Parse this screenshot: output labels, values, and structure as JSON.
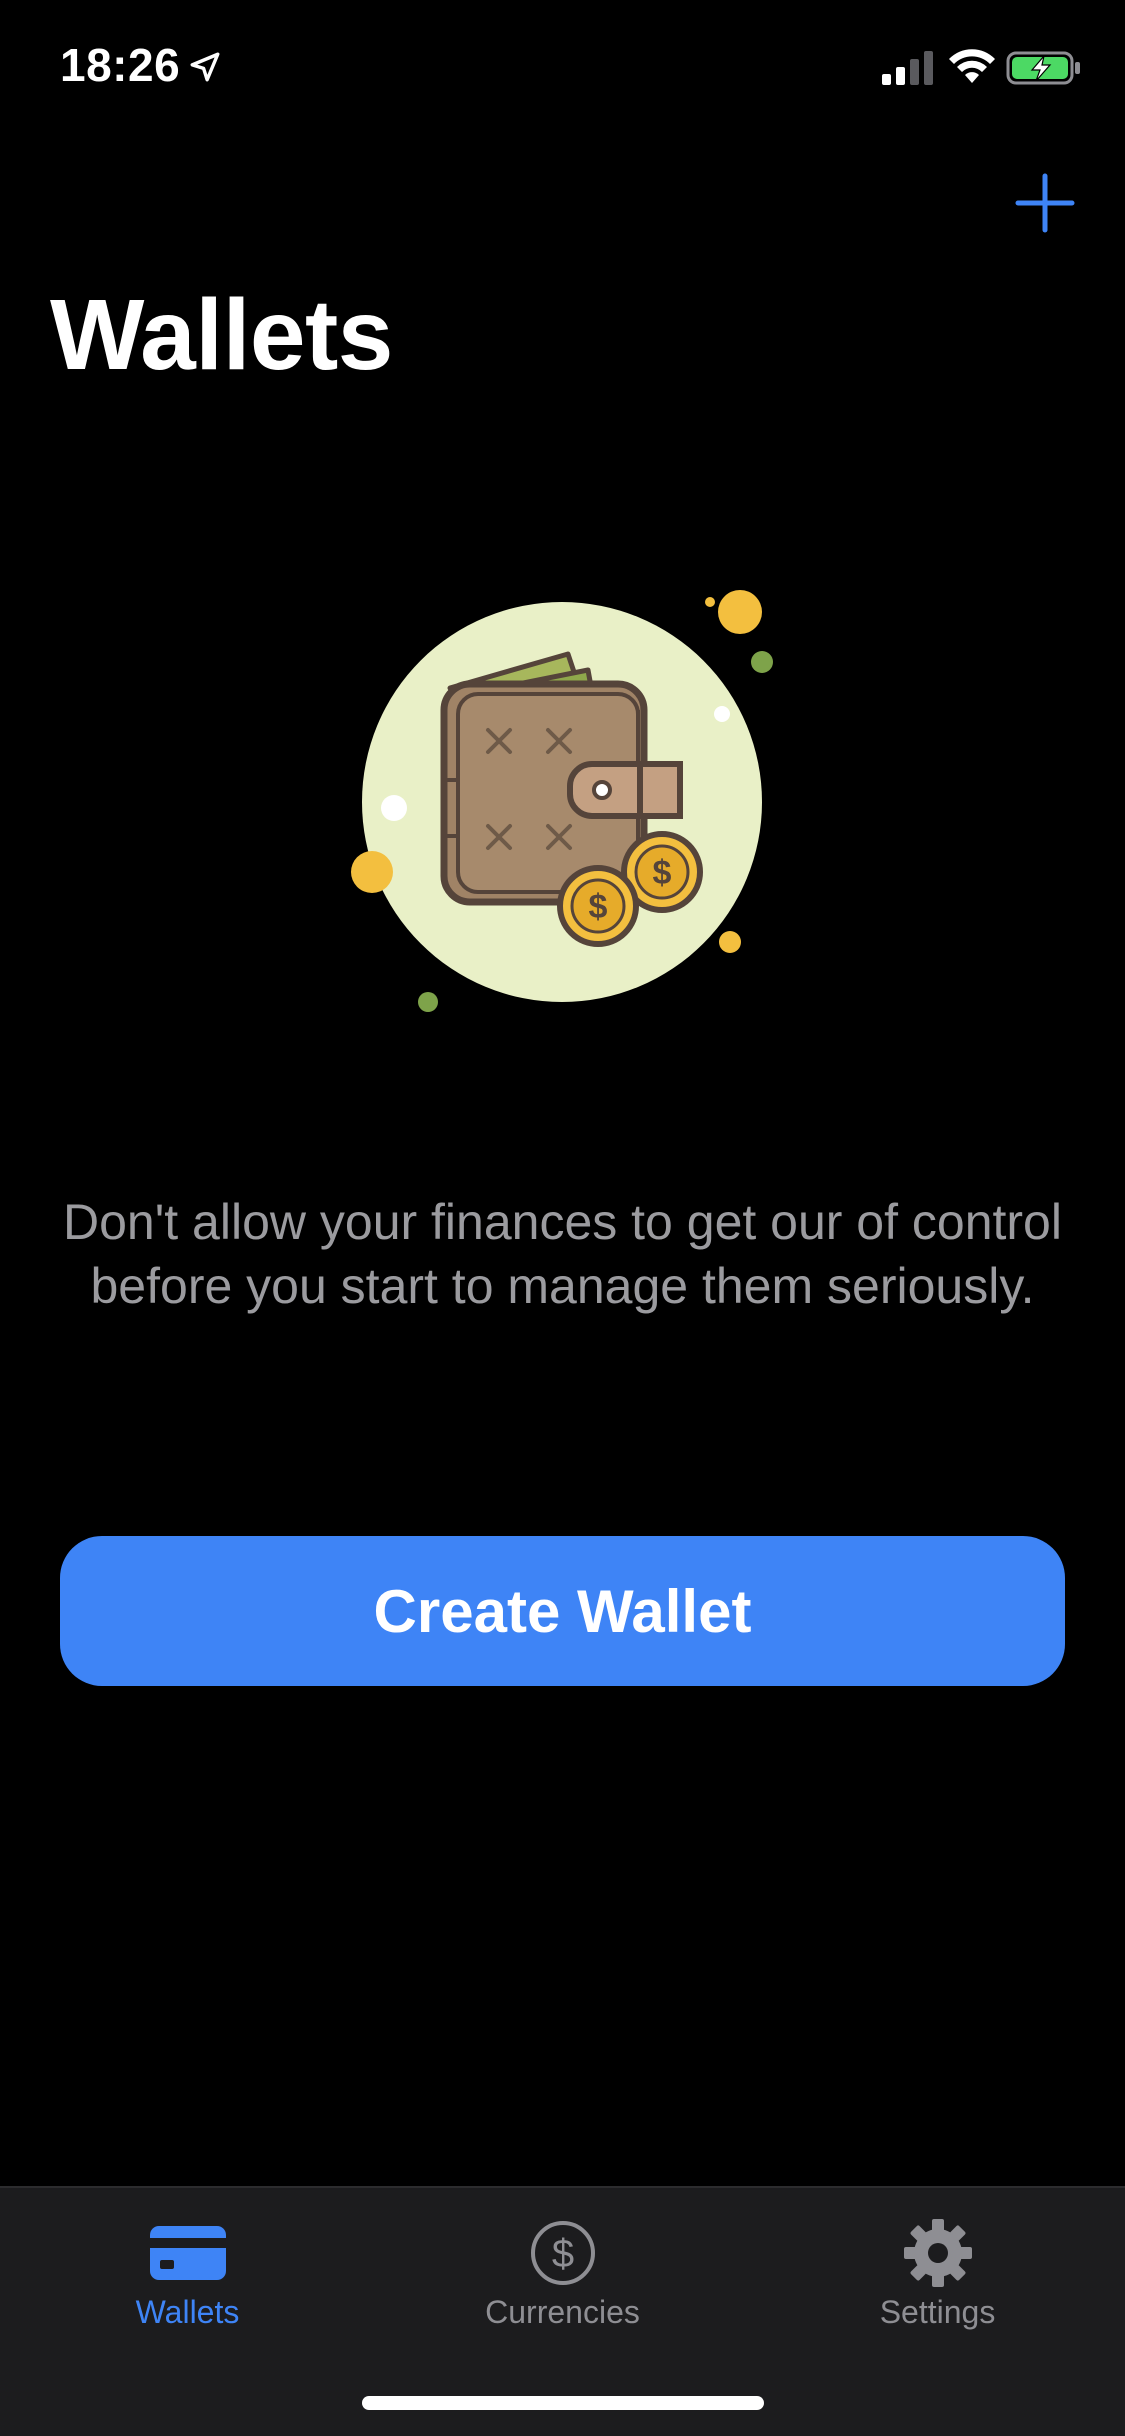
{
  "status_bar": {
    "time": "18:26"
  },
  "nav": {
    "add_icon": "plus-icon",
    "title": "Wallets"
  },
  "empty_state": {
    "illustration": "wallet-illustration",
    "message": "Don't allow your finances to get our of control before you start to manage them seriously.",
    "button_label": "Create Wallet"
  },
  "tab_bar": {
    "items": [
      {
        "label": "Wallets",
        "icon": "card-icon",
        "active": true
      },
      {
        "label": "Currencies",
        "icon": "dollar-circle-icon",
        "active": false
      },
      {
        "label": "Settings",
        "icon": "gear-icon",
        "active": false
      }
    ]
  },
  "colors": {
    "accent": "#3e84f6",
    "background": "#000000",
    "tab_bar_bg": "#1c1c1e",
    "secondary_text": "#9b9b9f"
  }
}
